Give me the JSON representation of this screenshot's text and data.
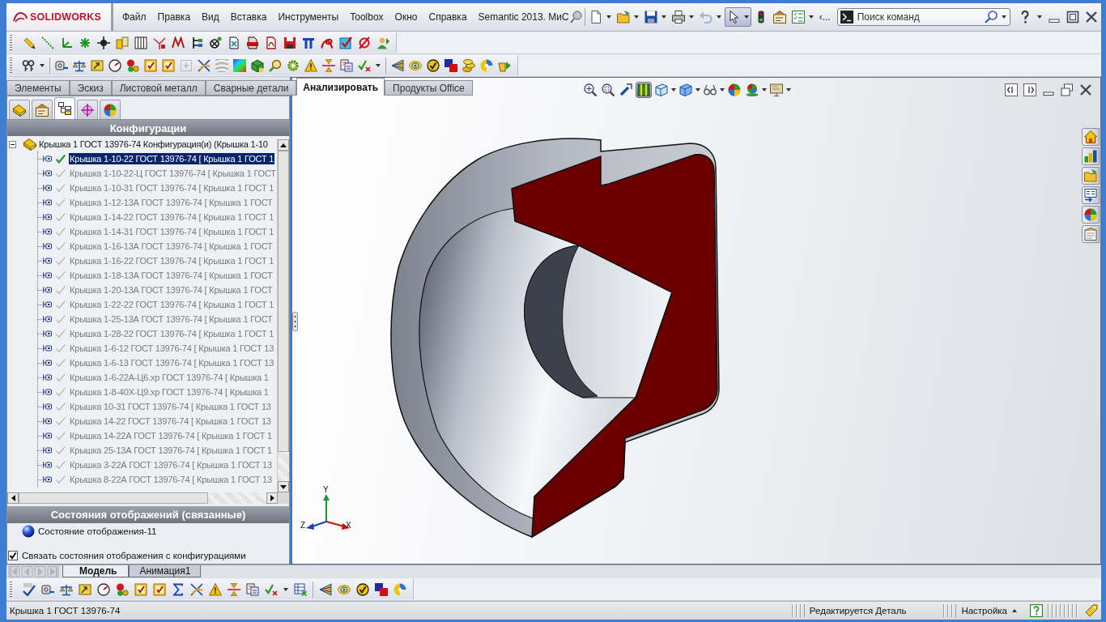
{
  "menu_bar": {
    "logo": "SOLIDWORKS",
    "items": [
      "Файл",
      "Правка",
      "Вид",
      "Вставка",
      "Инструменты",
      "Toolbox",
      "Окно",
      "Справка",
      "Semantic 2013. МиС"
    ]
  },
  "quick_access": {
    "buttons": [
      {
        "pressed": false,
        "disabled": false
      },
      {
        "pressed": false,
        "disabled": false
      },
      {
        "pressed": false,
        "disabled": false
      },
      {
        "pressed": false,
        "disabled": false
      },
      {
        "pressed": false,
        "disabled": true
      },
      {
        "pressed": true,
        "disabled": false
      },
      {
        "pressed": false,
        "disabled": false
      },
      {
        "pressed": false,
        "disabled": false
      },
      {
        "pressed": false,
        "disabled": false
      }
    ],
    "overflow": "‹..."
  },
  "command_search": {
    "placeholder": "Поиск команд"
  },
  "analysis_toolbar": [
    {
      "disabled": false
    },
    {
      "disabled": false
    },
    {
      "disabled": false
    },
    {
      "disabled": false
    },
    {
      "disabled": false
    },
    {
      "disabled": false
    },
    {
      "disabled": false
    },
    {
      "disabled": false
    },
    {
      "disabled": true
    },
    {
      "disabled": false
    },
    {
      "disabled": false
    },
    {
      "disabled": false
    },
    {
      "disabled": false
    },
    {
      "disabled": false
    },
    {
      "disabled": false
    },
    {
      "disabled": false
    },
    {
      "disabled": false
    },
    {
      "disabled": false
    },
    {
      "disabled": false
    },
    {
      "disabled": false
    },
    {
      "disabled": false
    },
    {
      "disabled": false
    },
    {
      "disabled": false
    },
    {
      "disabled": false
    },
    {
      "disabled": false
    },
    {
      "disabled": false
    }
  ],
  "command_tabs": [
    {
      "label": "Элементы",
      "selected": false
    },
    {
      "label": "Эскиз",
      "selected": false
    },
    {
      "label": "Листовой металл",
      "selected": false
    },
    {
      "label": "Сварные детали",
      "selected": false
    },
    {
      "label": "Анализировать",
      "selected": true
    },
    {
      "label": "Продукты Office",
      "selected": false
    }
  ],
  "panel_tabs": [
    {
      "selected": false
    },
    {
      "selected": false
    },
    {
      "selected": true
    },
    {
      "selected": false
    },
    {
      "selected": false
    }
  ],
  "configuration_manager": {
    "header": "Конфигурации",
    "root": {
      "label": "Крышка 1 ГОСТ 13976-74 Конфигурация(и) (Крышка 1-10",
      "expanded": true,
      "children": [
        {
          "label": "Крышка 1-10-22 ГОСТ 13976-74 [ Крышка 1 ГОСТ 1",
          "active": true,
          "selected": true
        },
        {
          "label": "Крышка 1-10-22-Ц ГОСТ 13976-74 [ Крышка 1 ГОСТ",
          "active": false,
          "selected": false
        },
        {
          "label": "Крышка 1-10-31 ГОСТ 13976-74 [ Крышка 1 ГОСТ 1",
          "active": false,
          "selected": false
        },
        {
          "label": "Крышка 1-12-13А ГОСТ 13976-74 [ Крышка 1 ГОСТ",
          "active": false,
          "selected": false
        },
        {
          "label": "Крышка 1-14-22 ГОСТ 13976-74 [ Крышка 1 ГОСТ 1",
          "active": false,
          "selected": false
        },
        {
          "label": "Крышка 1-14-31 ГОСТ 13976-74 [ Крышка 1 ГОСТ 1",
          "active": false,
          "selected": false
        },
        {
          "label": "Крышка 1-16-13А ГОСТ 13976-74 [ Крышка 1 ГОСТ",
          "active": false,
          "selected": false
        },
        {
          "label": "Крышка 1-16-22 ГОСТ 13976-74 [ Крышка 1 ГОСТ 1",
          "active": false,
          "selected": false
        },
        {
          "label": "Крышка 1-18-13А ГОСТ 13976-74 [ Крышка 1 ГОСТ",
          "active": false,
          "selected": false
        },
        {
          "label": "Крышка 1-20-13А ГОСТ 13976-74 [ Крышка 1 ГОСТ",
          "active": false,
          "selected": false
        },
        {
          "label": "Крышка 1-22-22 ГОСТ 13976-74 [ Крышка 1 ГОСТ 1",
          "active": false,
          "selected": false
        },
        {
          "label": "Крышка 1-25-13А ГОСТ 13976-74 [ Крышка 1 ГОСТ",
          "active": false,
          "selected": false
        },
        {
          "label": "Крышка 1-28-22 ГОСТ 13976-74 [ Крышка 1 ГОСТ 1",
          "active": false,
          "selected": false
        },
        {
          "label": "Крышка 1-6-12 ГОСТ 13976-74 [ Крышка 1 ГОСТ 13",
          "active": false,
          "selected": false
        },
        {
          "label": "Крышка 1-6-13 ГОСТ 13976-74 [ Крышка 1 ГОСТ 13",
          "active": false,
          "selected": false
        },
        {
          "label": "Крышка 1-6-22А-Ц6.хр ГОСТ 13976-74 [ Крышка 1",
          "active": false,
          "selected": false
        },
        {
          "label": "Крышка 1-8-40Х-Ц9.хр ГОСТ 13976-74 [ Крышка 1",
          "active": false,
          "selected": false
        },
        {
          "label": "Крышка 10-31 ГОСТ 13976-74 [ Крышка 1 ГОСТ 13",
          "active": false,
          "selected": false
        },
        {
          "label": "Крышка 14-22 ГОСТ 13976-74 [ Крышка 1 ГОСТ 13",
          "active": false,
          "selected": false
        },
        {
          "label": "Крышка 14-22А ГОСТ 13976-74 [ Крышка 1 ГОСТ 1",
          "active": false,
          "selected": false
        },
        {
          "label": "Крышка 25-13А ГОСТ 13976-74 [ Крышка 1 ГОСТ 1",
          "active": false,
          "selected": false
        },
        {
          "label": "Крышка 3-22А ГОСТ 13976-74 [ Крышка 1 ГОСТ 13",
          "active": false,
          "selected": false
        },
        {
          "label": "Крышка 8-22А ГОСТ 13976-74 [ Крышка 1 ГОСТ 13",
          "active": false,
          "selected": false
        }
      ]
    }
  },
  "display_states": {
    "header": "Состояния отображений (связанные)",
    "items": [
      "Состояние отображения-11"
    ],
    "link_checkbox": {
      "label": "Связать состояния отображения с конфигурациями",
      "checked": true
    }
  },
  "view_toolbar": [
    {
      "pressed": false
    },
    {
      "pressed": false
    },
    {
      "pressed": false
    },
    {
      "pressed": true
    },
    {
      "pressed": false
    },
    {
      "pressed": false
    },
    {
      "pressed": false
    },
    {
      "pressed": false
    },
    {
      "pressed": false
    },
    {
      "pressed": false
    }
  ],
  "triad": {
    "x": "X",
    "y": "Y",
    "z": "Z"
  },
  "model_tabs": {
    "nav_disabled": true,
    "tabs": [
      {
        "label": "Модель",
        "selected": true
      },
      {
        "label": "Анимация1",
        "selected": false
      }
    ]
  },
  "status_bar": {
    "document": "Крышка 1 ГОСТ 13976-74",
    "mode": "Редактируется Деталь",
    "units": "Настройка"
  }
}
